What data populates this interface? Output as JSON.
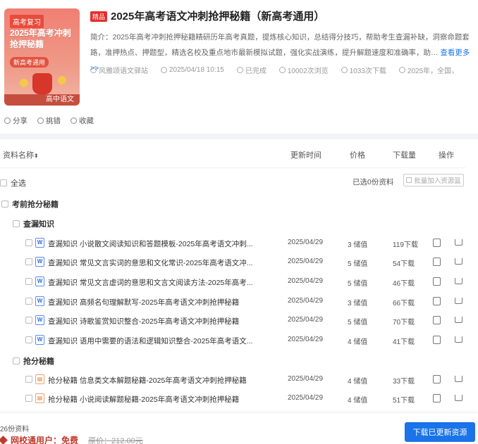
{
  "cover": {
    "tag": "高考复习",
    "headline": "2025年高考冲刺抢押秘籍",
    "subtag": "新高考通用",
    "bottom_label": "高中语文"
  },
  "header": {
    "badge": "精品",
    "title": "2025年高考语文冲刺抢押秘籍（新高考通用）",
    "intro": "简介：2025年高考冲刺抢押秘籍精研历年高考真题，提炼核心知识，总结得分技巧，帮助考生查漏补缺，洞察命题套路，准押热点、押题型，精选名校及重点地市最新模拟试题，强化实战演练，提升解题速度和准确率，助…",
    "more_link": "查看更多>>",
    "meta": {
      "author": "风雅颂语文驿站",
      "date": "2025/04/18 10:15",
      "status": "已完成",
      "views": "10002次浏览",
      "downloads": "1033次下载",
      "scope": "2025年，全国，"
    },
    "actions": {
      "share": "分享",
      "report": "挑错",
      "favorite": "收藏"
    }
  },
  "table": {
    "headers": {
      "name": "资料名称",
      "updated": "更新时间",
      "price": "价格",
      "downloads": "下载量",
      "ops": "操作"
    },
    "select_all": "全选",
    "selected_text": "已选0份资料",
    "batch_button": "批量加入资源篮",
    "group_top": "考前抢分秘籍",
    "subgroup_1": "查漏知识",
    "subgroup_2": "抢分秘籍",
    "rows": [
      {
        "icon": "W",
        "name": "查漏知识 小说散文阅读知识和答题模板-2025年高考语文冲刺...",
        "date": "2025/04/29",
        "price": "3 储值",
        "dl": "119下载"
      },
      {
        "icon": "W",
        "name": "查漏知识 常见文言实词的意思和文化常识-2025年高考语文冲...",
        "date": "2025/04/29",
        "price": "5 储值",
        "dl": "54下载"
      },
      {
        "icon": "W",
        "name": "查漏知识 常见文言虚词的意思和文言文阅读方法-2025年高考...",
        "date": "2025/04/29",
        "price": "5 储值",
        "dl": "46下载"
      },
      {
        "icon": "W",
        "name": "查漏知识 高频名句理解默写-2025年高考语文冲刺抢押秘籍",
        "date": "2025/04/29",
        "price": "3 储值",
        "dl": "66下载"
      },
      {
        "icon": "W",
        "name": "查漏知识 诗歌鉴赏知识整合-2025年高考语文冲刺抢押秘籍",
        "date": "2025/04/29",
        "price": "5 储值",
        "dl": "70下载"
      },
      {
        "icon": "W",
        "name": "查漏知识 语用中需要的语法和逻辑知识整合-2025年高考语文...",
        "date": "2025/04/29",
        "price": "4 储值",
        "dl": "41下载"
      },
      {
        "icon": "P",
        "name": "抢分秘籍 信息类文本解题秘籍-2025年高考语文冲刺抢押秘籍",
        "date": "2025/04/29",
        "price": "4 储值",
        "dl": "33下载"
      },
      {
        "icon": "P",
        "name": "抢分秘籍 小说阅读解题秘籍-2025年高考语文冲刺抢押秘籍",
        "date": "2025/04/29",
        "price": "4 储值",
        "dl": "51下载"
      }
    ]
  },
  "footer": {
    "count": "26份资料",
    "vip_label": "网校通用户：免费",
    "orig_price": "原价：212.00元",
    "download_button": "下载已更新资源"
  }
}
